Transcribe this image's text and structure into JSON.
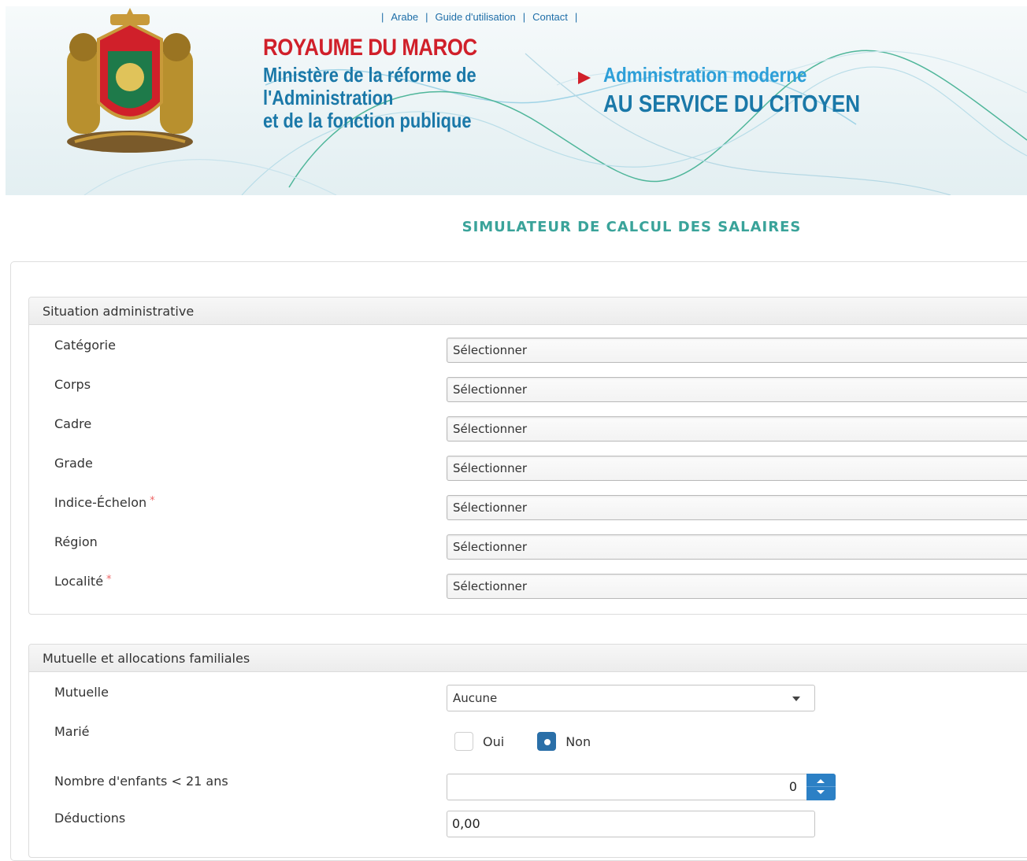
{
  "header": {
    "links": [
      "Arabe",
      "Guide d'utilisation",
      "Contact"
    ],
    "kingdom": "ROYAUME DU MAROC",
    "ministry_lines": [
      "Ministère de la réforme de",
      "l'Administration",
      "et de la fonction publique"
    ],
    "slogan_line1": "Administration moderne",
    "slogan_line2": "AU SERVICE DU CITOYEN",
    "colors": {
      "red": "#d0202a",
      "blue": "#1a78a8",
      "light_blue": "#2d9fd8"
    }
  },
  "page_title": "SIMULATEUR DE CALCUL DES SALAIRES",
  "situation": {
    "title": "Situation administrative",
    "fields": [
      {
        "label": "Catégorie",
        "value": "Sélectionner",
        "required": false
      },
      {
        "label": "Corps",
        "value": "Sélectionner",
        "required": false
      },
      {
        "label": "Cadre",
        "value": "Sélectionner",
        "required": false
      },
      {
        "label": "Grade",
        "value": "Sélectionner",
        "required": false
      },
      {
        "label": "Indice-Échelon",
        "value": "Sélectionner",
        "required": true
      },
      {
        "label": "Région",
        "value": "Sélectionner",
        "required": false
      },
      {
        "label": "Localité",
        "value": "Sélectionner",
        "required": true
      }
    ],
    "required_mark": "*"
  },
  "mutuelle": {
    "title": "Mutuelle et allocations familiales",
    "mutuelle_label": "Mutuelle",
    "mutuelle_value": "Aucune",
    "marie_label": "Marié",
    "marie_options": [
      {
        "label": "Oui",
        "checked": false
      },
      {
        "label": "Non",
        "checked": true
      }
    ],
    "enfants_label": "Nombre d'enfants < 21 ans",
    "enfants_value": "0",
    "deductions_label": "Déductions",
    "deductions_value": "0,00"
  }
}
